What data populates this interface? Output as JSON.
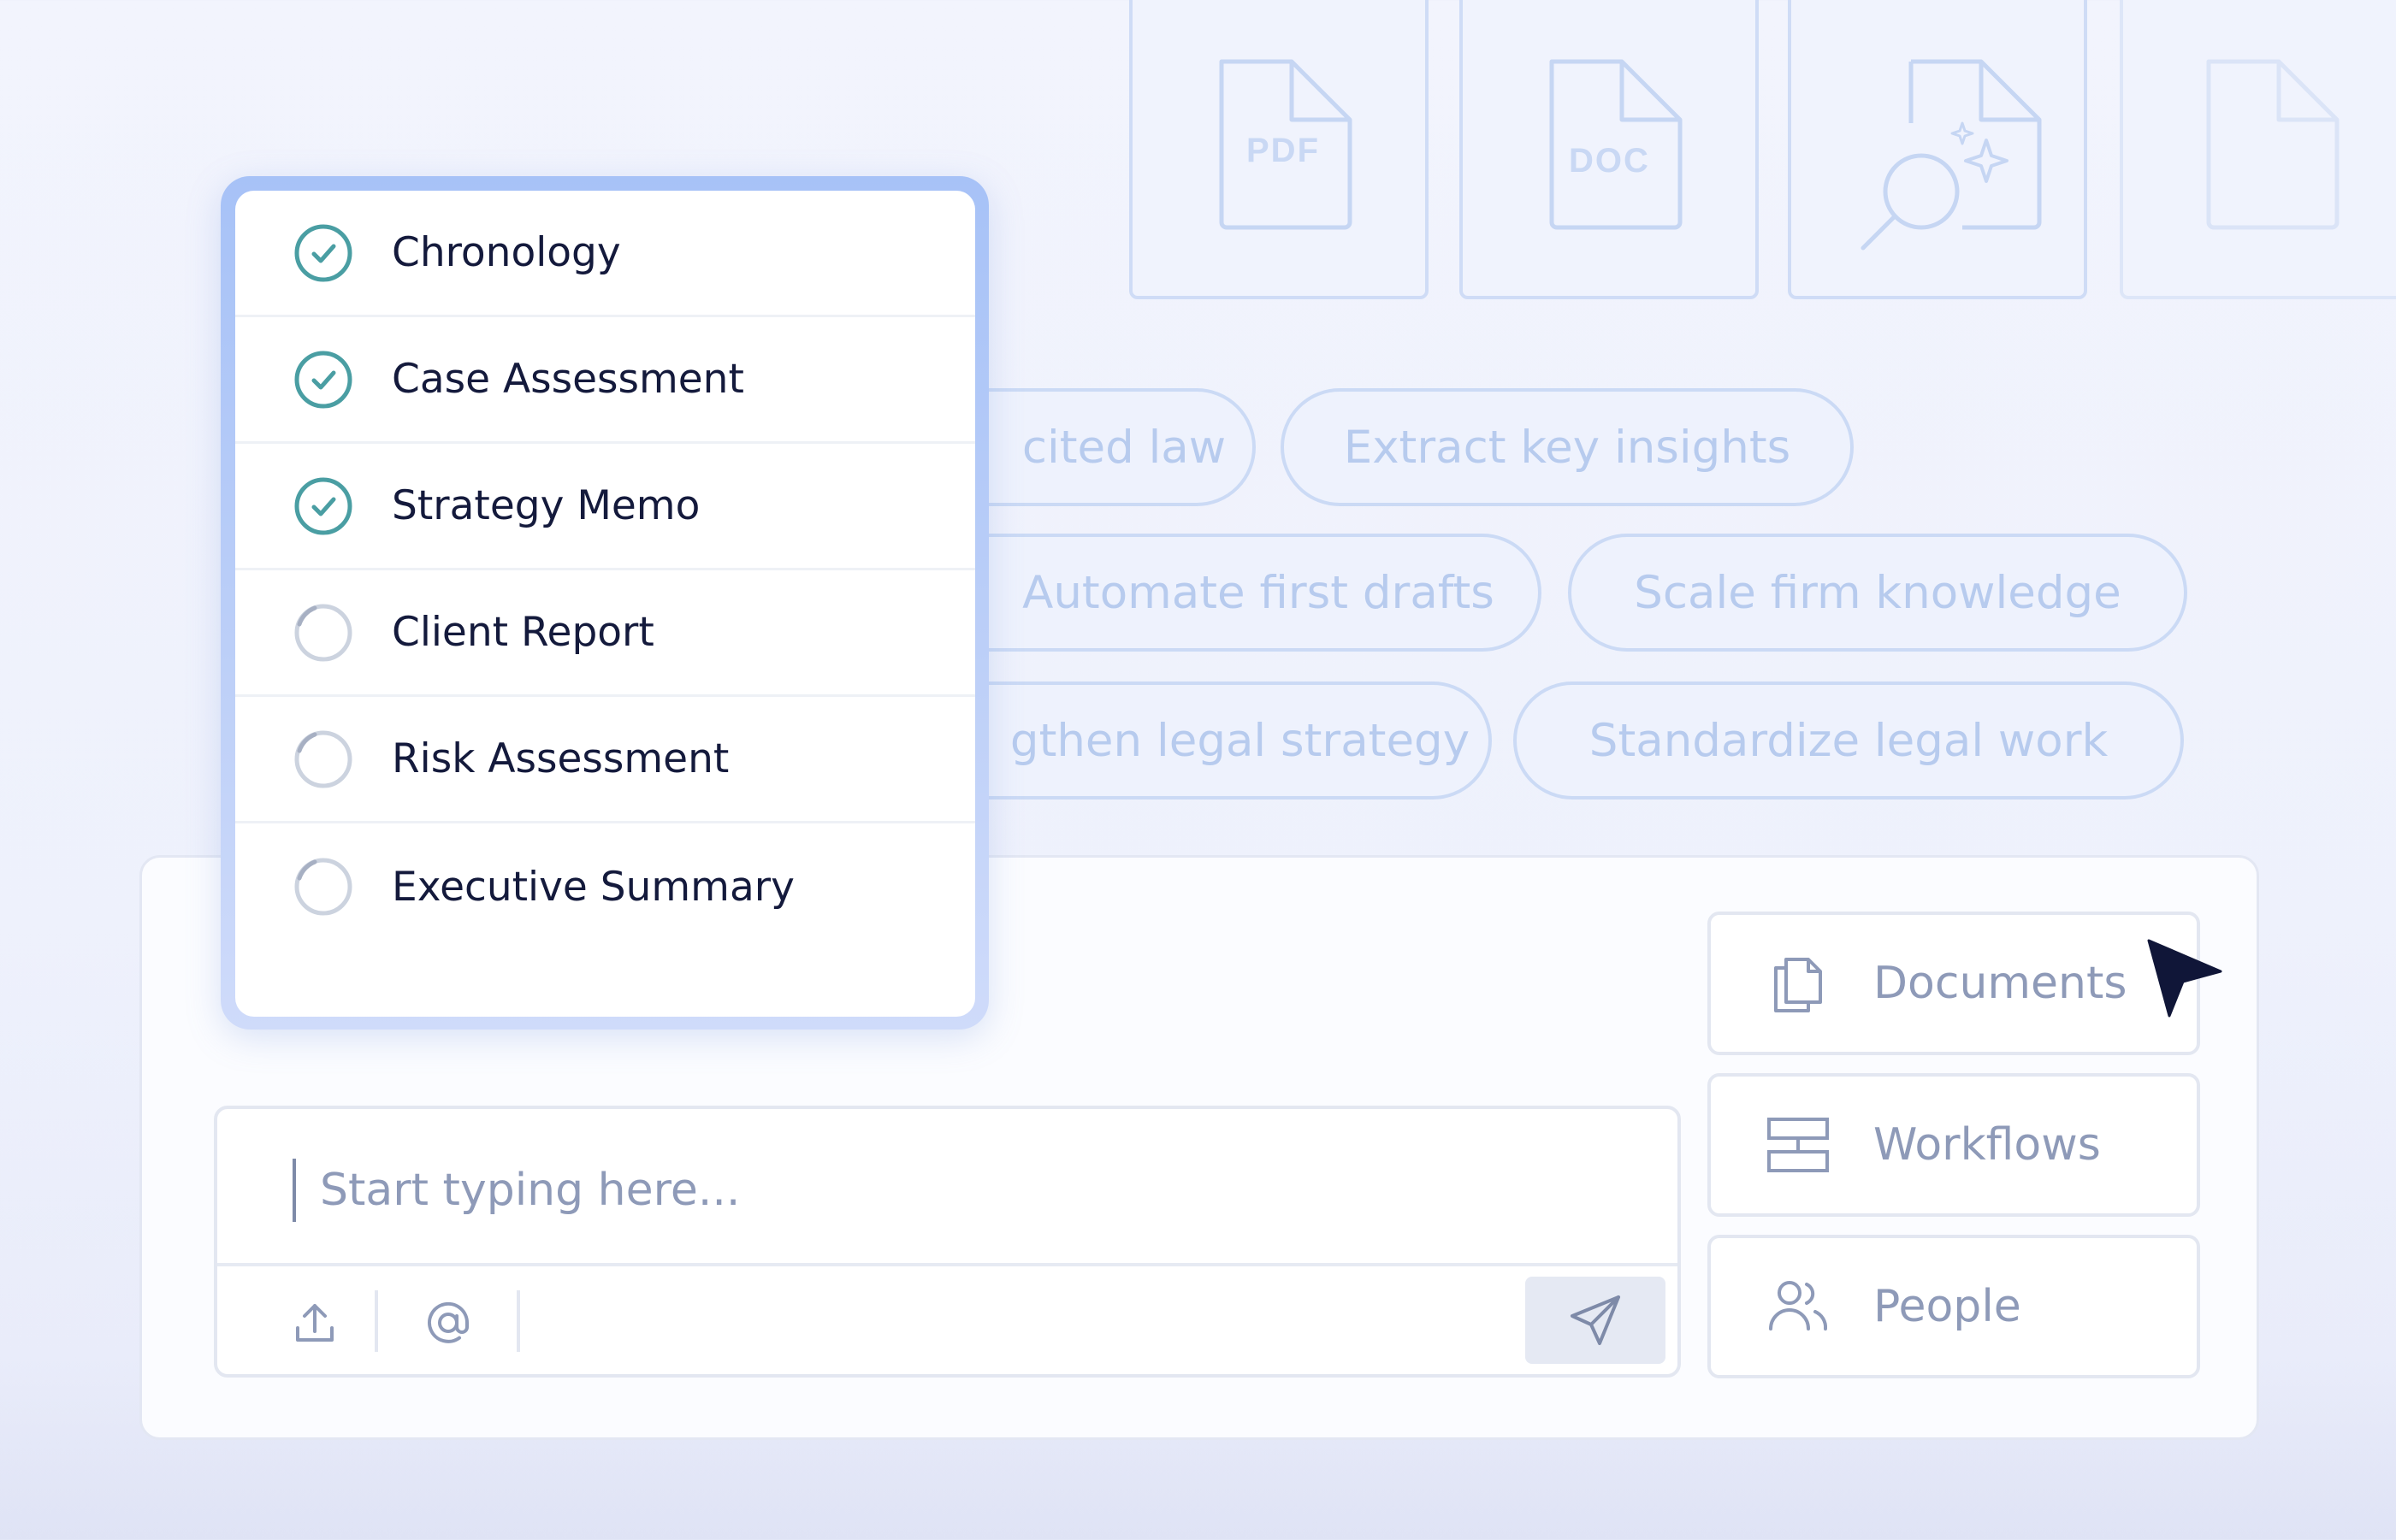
{
  "file_cards": [
    {
      "type": "PDF",
      "icon": "pdf-file-icon"
    },
    {
      "type": "DOC",
      "icon": "doc-file-icon"
    },
    {
      "type": "",
      "icon": "search-file-icon"
    },
    {
      "type": "",
      "icon": "blank-file-icon"
    }
  ],
  "pills": [
    "cited law",
    "Extract key insights",
    "Automate first drafts",
    "Scale firm knowledge",
    "gthen legal strategy",
    "Standardize legal work"
  ],
  "tasks": [
    {
      "label": "Chronology",
      "status": "done"
    },
    {
      "label": "Case Assessment",
      "status": "done"
    },
    {
      "label": "Strategy Memo",
      "status": "done"
    },
    {
      "label": "Client Report",
      "status": "loading"
    },
    {
      "label": "Risk Assessment",
      "status": "loading"
    },
    {
      "label": "Executive Summary",
      "status": "loading"
    }
  ],
  "composer": {
    "placeholder": "Start typing here..."
  },
  "side_buttons": [
    {
      "label": "Documents",
      "icon": "documents-icon"
    },
    {
      "label": "Workflows",
      "icon": "workflows-icon"
    },
    {
      "label": "People",
      "icon": "people-icon"
    }
  ],
  "colors": {
    "accent_done": "#4a9ea3",
    "pending": "#ccd3df",
    "text_dark": "#141a3c",
    "muted": "#8e9ab8",
    "pill_text": "#b7cbee",
    "cursor": "#101638"
  }
}
